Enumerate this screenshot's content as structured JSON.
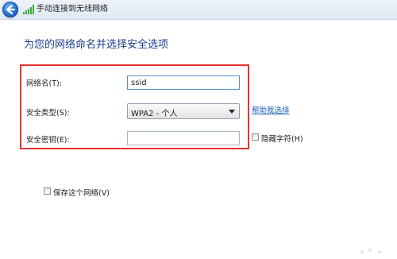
{
  "window": {
    "title": "手动连接到无线网络"
  },
  "page": {
    "heading": "为您的网络命名并选择安全选项"
  },
  "form": {
    "network_name": {
      "label": "网络名(T):",
      "value": "ssid"
    },
    "security_type": {
      "label": "安全类型(S):",
      "selected": "WPA2 - 个人",
      "help_link": "帮助我选择"
    },
    "security_key": {
      "label": "安全密钥(E):",
      "value": "",
      "hide_chars_label": "隐藏字符(H)"
    },
    "save_network_label": "保存这个网络(V)"
  },
  "colors": {
    "highlight_border": "#e8332f",
    "heading": "#1b3f8f",
    "link": "#1a5bb5"
  }
}
